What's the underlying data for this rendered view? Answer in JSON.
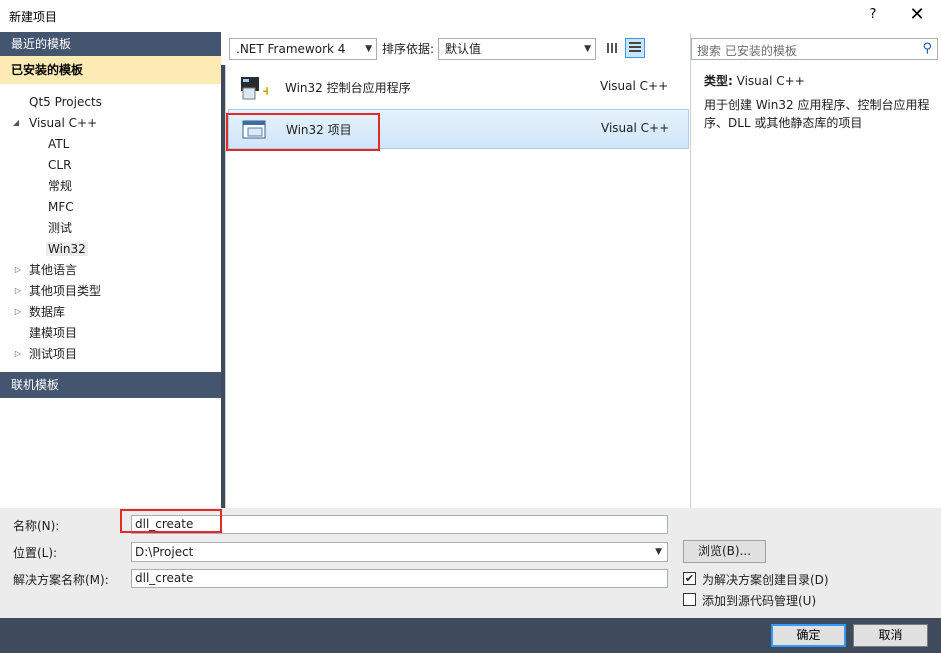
{
  "window": {
    "title": "新建项目",
    "help_label": "?",
    "close_label": "✕"
  },
  "left": {
    "recent_header": "最近的模板",
    "installed_header": "已安装的模板",
    "online_header": "联机模板",
    "tree": [
      {
        "label": "Qt5 Projects",
        "arrow": ""
      },
      {
        "label": "Visual C++",
        "arrow": "◢"
      },
      {
        "label": "ATL",
        "arrow": ""
      },
      {
        "label": "CLR",
        "arrow": ""
      },
      {
        "label": "常规",
        "arrow": ""
      },
      {
        "label": "MFC",
        "arrow": ""
      },
      {
        "label": "测试",
        "arrow": ""
      },
      {
        "label": "Win32",
        "arrow": ""
      },
      {
        "label": "其他语言",
        "arrow": "▷"
      },
      {
        "label": "其他项目类型",
        "arrow": "▷"
      },
      {
        "label": "数据库",
        "arrow": "▷"
      },
      {
        "label": "建模项目",
        "arrow": ""
      },
      {
        "label": "测试项目",
        "arrow": "▷"
      }
    ]
  },
  "toolbar": {
    "framework": ".NET Framework 4",
    "sort_label": "排序依据:",
    "sort_value": "默认值"
  },
  "templates": [
    {
      "name": "Win32 控制台应用程序",
      "lang": "Visual C++"
    },
    {
      "name": "Win32 项目",
      "lang": "Visual C++"
    }
  ],
  "details": {
    "search_placeholder": "搜索 已安装的模板",
    "type_label": "类型:",
    "type_value": "Visual C++",
    "description": "用于创建 Win32 应用程序、控制台应用程序、DLL 或其他静态库的项目"
  },
  "form": {
    "name_label": "名称(N):",
    "name_value": "dll_create",
    "location_label": "位置(L):",
    "location_value": "D:\\Project",
    "solution_label": "解决方案名称(M):",
    "solution_value": "dll_create",
    "browse_label": "浏览(B)...",
    "create_dir_label": "为解决方案创建目录(D)",
    "create_dir_checked": true,
    "source_control_label": "添加到源代码管理(U)",
    "source_control_checked": false
  },
  "buttons": {
    "ok": "确定",
    "cancel": "取消"
  },
  "colors": {
    "header_bg": "#44556f",
    "selected_bg": "#fcebb5",
    "footer_bg": "#3f4a5c",
    "highlight_red": "#e32a2a"
  }
}
